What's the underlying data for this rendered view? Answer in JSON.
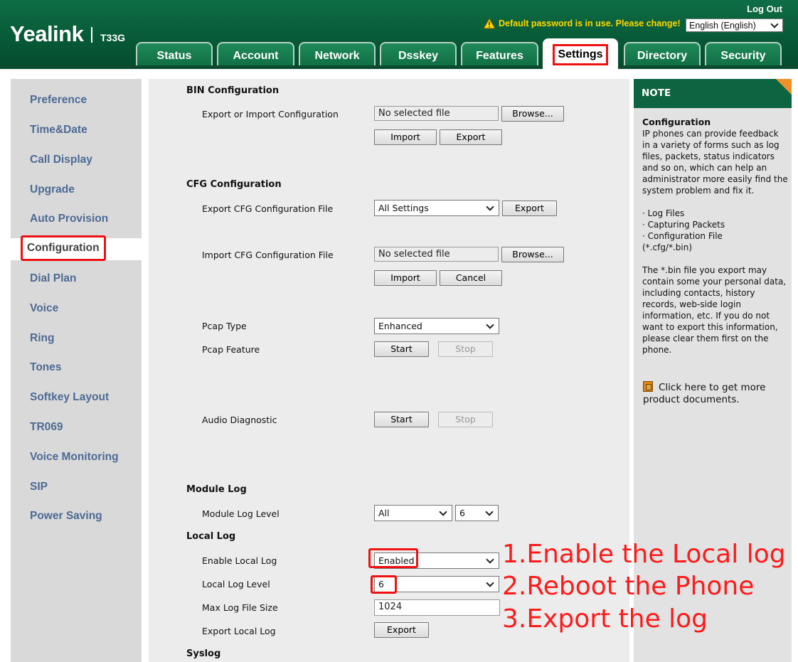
{
  "header": {
    "logo": "Yealink",
    "model": "T33G",
    "logout": "Log Out",
    "warning": "Default password is in use. Please change!",
    "language": "English (English)",
    "tabs": [
      "Status",
      "Account",
      "Network",
      "Dsskey",
      "Features",
      "Settings",
      "Directory",
      "Security"
    ],
    "active_tab": "Settings"
  },
  "sidebar": {
    "items": [
      "Preference",
      "Time&Date",
      "Call Display",
      "Upgrade",
      "Auto Provision",
      "Configuration",
      "Dial Plan",
      "Voice",
      "Ring",
      "Tones",
      "Softkey Layout",
      "TR069",
      "Voice Monitoring",
      "SIP",
      "Power Saving"
    ],
    "active": "Configuration"
  },
  "bin": {
    "title": "BIN Configuration",
    "export_import_label": "Export or Import Configuration",
    "file_value": "No selected file",
    "browse": "Browse...",
    "import": "Import",
    "export": "Export"
  },
  "cfg": {
    "title": "CFG Configuration",
    "export_label": "Export CFG Configuration File",
    "export_select": "All Settings",
    "export_btn": "Export",
    "import_label": "Import CFG Configuration File",
    "file_value": "No selected file",
    "browse": "Browse...",
    "import": "Import",
    "cancel": "Cancel"
  },
  "pcap": {
    "type_label": "Pcap Type",
    "type_value": "Enhanced",
    "feature_label": "Pcap Feature",
    "start": "Start",
    "stop": "Stop"
  },
  "audio": {
    "label": "Audio Diagnostic",
    "start": "Start",
    "stop": "Stop"
  },
  "module_log": {
    "title": "Module Log",
    "level_label": "Module Log Level",
    "module_value": "All",
    "level_value": "6"
  },
  "local_log": {
    "title": "Local Log",
    "enable_label": "Enable Local Log",
    "enable_value": "Enabled",
    "level_label": "Local Log Level",
    "level_value": "6",
    "max_size_label": "Max Log File Size",
    "max_size_value": "1024",
    "export_label": "Export Local Log",
    "export_btn": "Export"
  },
  "syslog": {
    "title": "Syslog"
  },
  "note": {
    "header": "NOTE",
    "title": "Configuration",
    "lines": [
      "IP phones can provide feedback",
      "in a variety of forms such as log",
      "files, packets, status indicators",
      "and so on, which can help an",
      "administrator more easily find the",
      "system problem and fix it.",
      "",
      "· Log Files",
      "· Capturing Packets",
      "· Configuration File",
      "(*.cfg/*.bin)",
      "",
      "The *.bin file you export may",
      "contain some your personal data,",
      "including contacts, history",
      "records, web-side login",
      "information, etc. If you do not",
      "want to export this information,",
      "please clear them first on the",
      "phone."
    ],
    "doc_link_1": "Click here to get more",
    "doc_link_2": "product documents."
  },
  "instructions": [
    "1.Enable the Local log",
    "2.Reboot the Phone",
    "3.Export the log"
  ],
  "colors": {
    "brand_green": "#0d6440",
    "highlight_red": "#ee1111",
    "warning_yellow": "#ffd700",
    "note_corner": "#f0902b"
  }
}
